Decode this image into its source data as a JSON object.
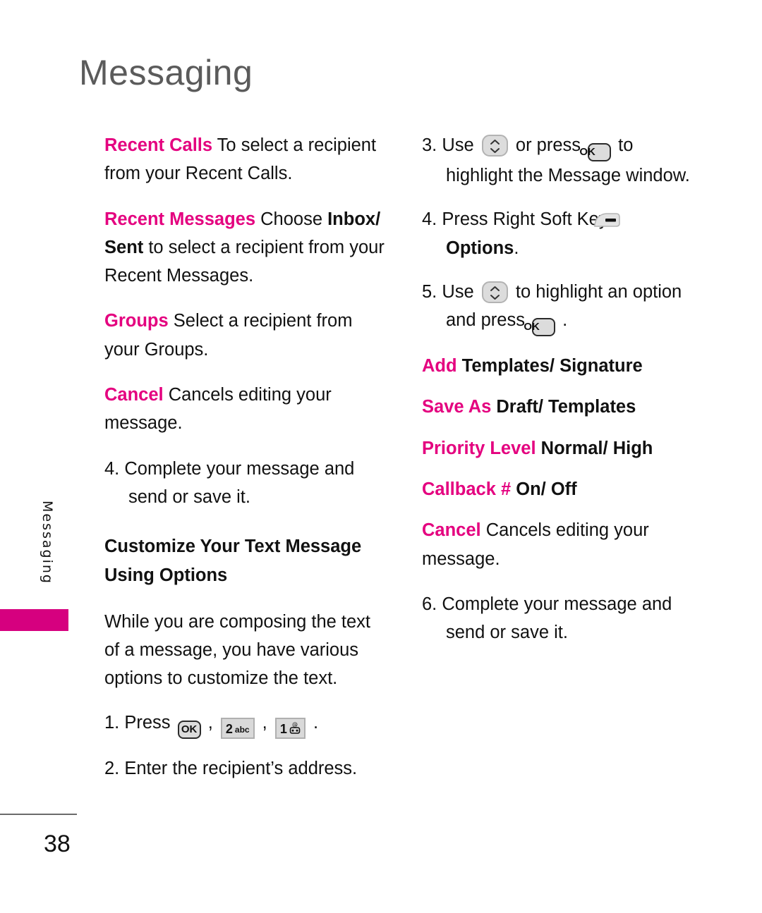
{
  "page": {
    "title": "Messaging",
    "side_tab_label": "Messaging",
    "number": "38",
    "accent_color": "#e4007f",
    "tab_color": "#d6007f",
    "title_color": "#5b5b5b"
  },
  "icons": {
    "ok_key": {
      "name": "ok-key-icon",
      "label": "OK"
    },
    "nav_key": {
      "name": "navigation-up-down-key-icon",
      "label": "up/down navigation key"
    },
    "key_2": {
      "name": "keypad-2-abc-icon",
      "num": "2",
      "sub": "abc"
    },
    "key_1": {
      "name": "keypad-1-voicemail-icon",
      "num": "1",
      "sub": "@"
    },
    "right_soft_key": {
      "name": "right-soft-key-icon",
      "label": "Right Soft Key"
    }
  },
  "left_column": {
    "definitions": [
      {
        "term": "Recent Calls",
        "text": " To select a recipient from your Recent Calls.",
        "term_bold": true
      },
      {
        "term": "Recent Messages",
        "text_pre": " Choose ",
        "bold_mid": "Inbox/ Sent",
        "text_post": " to select a recipient from your Recent Messages."
      },
      {
        "term": "Groups",
        "text": " Select a recipient from your Groups."
      },
      {
        "term": "Cancel",
        "text": "  Cancels editing your message."
      }
    ],
    "step4": "4. Complete your message and send or save it.",
    "heading_line1": "Customize Your Text Message",
    "heading_line2": "Using Options",
    "intro": "While you are composing the text of a message, you have various options to customize the text.",
    "step1_pre": "1. Press ",
    "step1_sep1": " , ",
    "step1_sep2": " , ",
    "step1_end": " .",
    "step2": "2. Enter the recipient’s address."
  },
  "right_column": {
    "step3_pre": "3. Use ",
    "step3_mid": " or press ",
    "step3_post": " to highlight the Message window.",
    "step4_pre": "4. Press Right Soft Key ",
    "step4_bold": "Options",
    "step4_post": ".",
    "step5_pre": "5. Use ",
    "step5_mid": " to highlight an option and press ",
    "step5_post": " .",
    "options": [
      {
        "term": "Add",
        "value": " Templates/ Signature",
        "value_bold": true
      },
      {
        "term": "Save As",
        "value": " Draft/ Templates",
        "value_bold": true
      },
      {
        "term": "Priority Level",
        "value": " Normal/ High",
        "value_bold": true
      },
      {
        "term": "Callback #",
        "value": " On/ Off",
        "value_bold": true
      },
      {
        "term": "Cancel",
        "value": " Cancels editing your message.",
        "value_bold": false
      }
    ],
    "step6": "6. Complete your message and send or save it."
  }
}
